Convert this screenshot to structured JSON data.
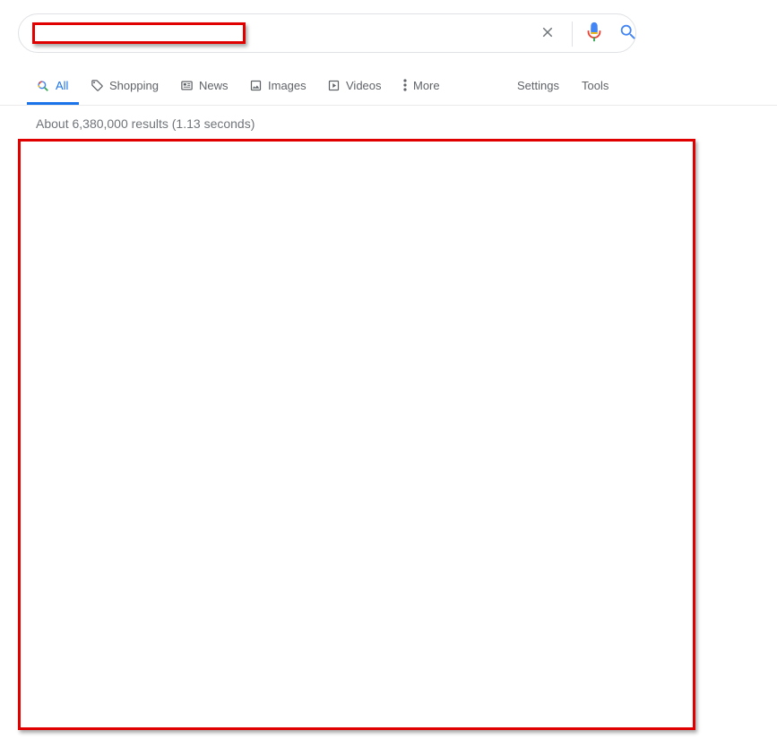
{
  "search": {
    "query": "",
    "clear_label": "Clear",
    "mic_label": "Search by voice",
    "submit_label": "Search"
  },
  "tabs": [
    {
      "label": "All",
      "icon": "search-icon",
      "active": true
    },
    {
      "label": "Shopping",
      "icon": "tag-icon"
    },
    {
      "label": "News",
      "icon": "newspaper-icon"
    },
    {
      "label": "Images",
      "icon": "image-icon"
    },
    {
      "label": "Videos",
      "icon": "play-icon"
    },
    {
      "label": "More",
      "icon": "more-vertical-icon"
    }
  ],
  "tools": {
    "settings_label": "Settings",
    "tools_label": "Tools"
  },
  "results": {
    "count_text": "About 6,380,000 results (1.13 seconds)"
  },
  "colors": {
    "accent": "#1a73e8",
    "redaction": "#e00000",
    "muted_text": "#5f6368"
  }
}
